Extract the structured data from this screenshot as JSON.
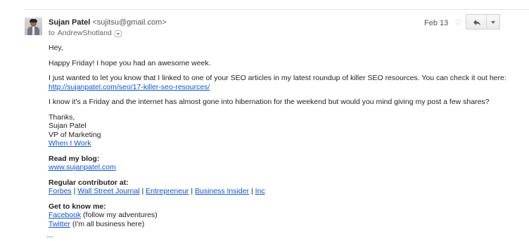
{
  "email": {
    "sender_name": "Sujan Patel",
    "sender_email": "<sujitsu@gmail.com>",
    "to_prefix": "to",
    "recipient": "AndrewShotland",
    "date": "Feb 13"
  },
  "body": {
    "greeting": "Hey,",
    "line1": "Happy Friday! I hope you had an awesome week.",
    "line2_text": "I just wanted to let you know that I linked to one of your SEO articles in my latest roundup of killer SEO resources. You can check it out here: ",
    "line2_link": "http://sujanpatel.com/seo/17-killer-seo-resources/",
    "line3": "I know it's a Friday and the internet has almost gone into hibernation for the weekend but would you mind giving my post a few shares?",
    "sig_thanks": "Thanks,",
    "sig_name": "Sujan Patel",
    "sig_title": "VP of Marketing",
    "sig_company": "When I Work",
    "blog_label": "Read my blog:",
    "blog_link": "www.sujanpatel.com",
    "contrib_label": "Regular contributor at:",
    "contrib_links": [
      "Forbes",
      "Wall Street Journal",
      "Entrepreneur",
      "Business Insider",
      "Inc"
    ],
    "contrib_sep": " | ",
    "know_label": "Get to know me:",
    "facebook_link": "Facebook",
    "facebook_note": " (follow my adventures)",
    "twitter_link": "Twitter",
    "twitter_note": " (I'm all business here)"
  },
  "icons": {
    "star": "star-icon",
    "reply": "reply-icon",
    "more": "chevron-down-icon",
    "recipient_details": "chevron-down-icon"
  }
}
